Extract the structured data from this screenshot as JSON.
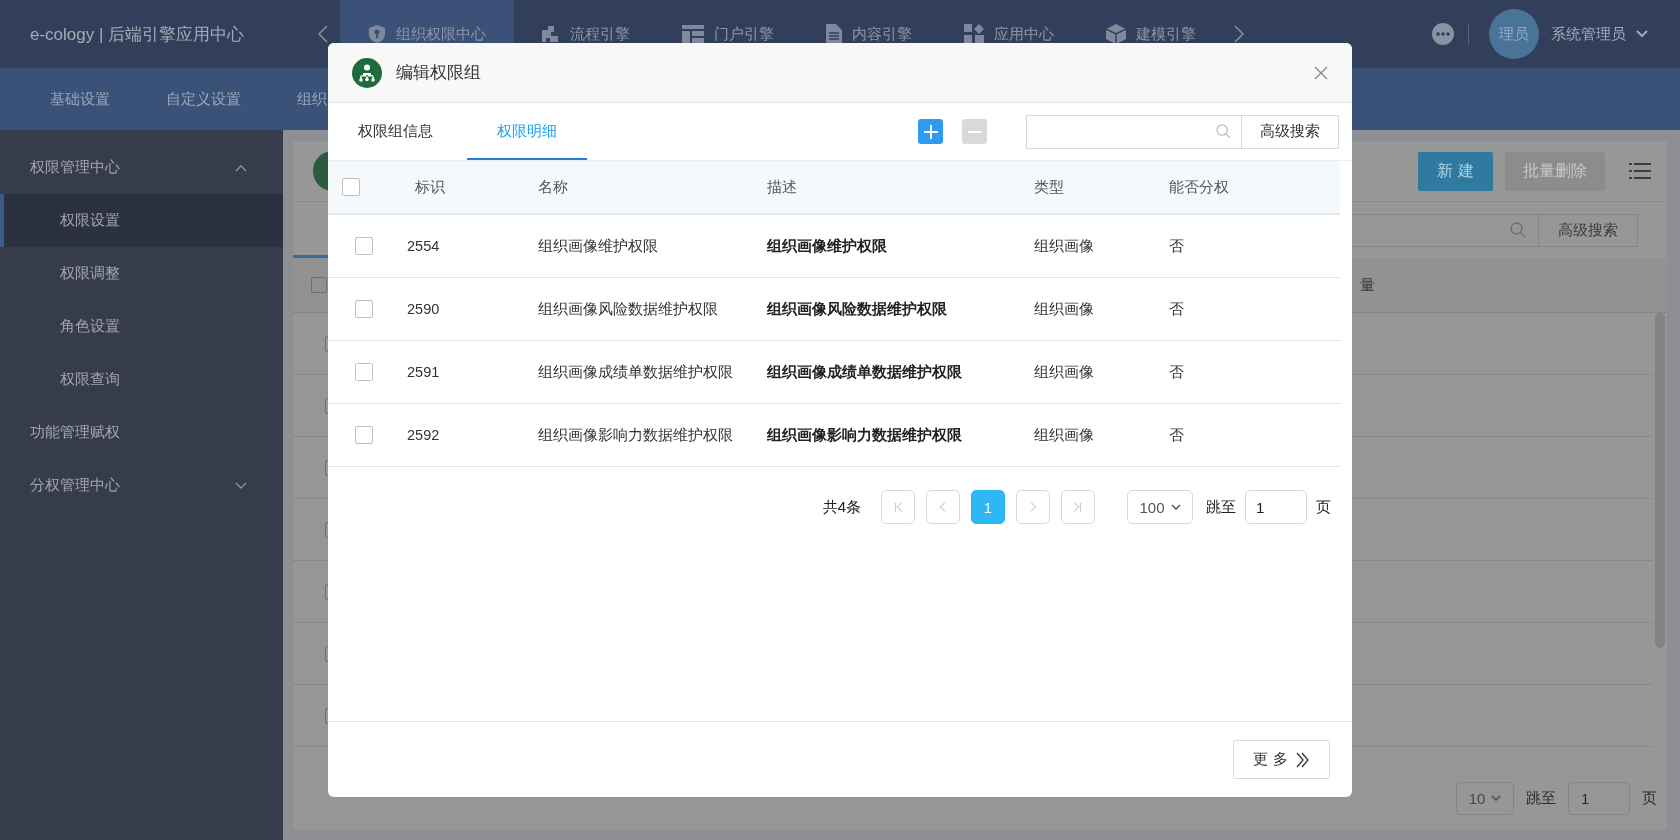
{
  "app": {
    "logo": "e-cology | 后端引擎应用中心"
  },
  "top_nav": {
    "tabs": [
      {
        "label": "组织权限中心",
        "selected": true
      },
      {
        "label": "流程引擎",
        "selected": false
      },
      {
        "label": "门户引擎",
        "selected": false
      },
      {
        "label": "内容引擎",
        "selected": false
      },
      {
        "label": "应用中心",
        "selected": false
      },
      {
        "label": "建模引擎",
        "selected": false
      }
    ]
  },
  "user": {
    "avatar_text": "理员",
    "name": "系统管理员"
  },
  "sub_nav": {
    "items": [
      "基础设置",
      "自定义设置",
      "组织"
    ]
  },
  "sidebar": {
    "items": [
      {
        "label": "权限管理中心",
        "kind": "group",
        "expanded": true,
        "children": [
          {
            "label": "权限设置",
            "selected": true
          },
          {
            "label": "权限调整",
            "selected": false
          },
          {
            "label": "角色设置",
            "selected": false
          },
          {
            "label": "权限查询",
            "selected": false
          }
        ]
      },
      {
        "label": "功能管理赋权",
        "kind": "link"
      },
      {
        "label": "分权管理中心",
        "kind": "group",
        "expanded": false
      }
    ]
  },
  "background": {
    "buttons": [
      {
        "label": "新 建",
        "disabled": false
      },
      {
        "label": "批量删除",
        "disabled": true
      }
    ],
    "search": {
      "button": "高级搜索"
    },
    "table": {
      "all_checked": false,
      "column_fragment": "量",
      "rows": [
        {
          "checked": false
        },
        {
          "checked": false
        },
        {
          "checked": false
        },
        {
          "checked": false
        },
        {
          "checked": false
        },
        {
          "checked": false
        },
        {
          "checked": false
        }
      ]
    },
    "pagination": {
      "page_size": "10",
      "jump_label": "跳至",
      "page_input": "1",
      "page_unit": "页"
    }
  },
  "modal": {
    "title": "编辑权限组",
    "tabs": [
      {
        "label": "权限组信息",
        "selected": false
      },
      {
        "label": "权限明细",
        "selected": true
      }
    ],
    "actions": [
      {
        "kind": "add",
        "disabled": false
      },
      {
        "kind": "remove",
        "disabled": true
      }
    ],
    "search": {
      "button": "高级搜索"
    },
    "table": {
      "all_checked": false,
      "columns": [
        "标识",
        "名称",
        "描述",
        "类型",
        "能否分权"
      ],
      "rows": [
        {
          "checked": false,
          "id": "2554",
          "name": "组织画像维护权限",
          "description": "组织画像维护权限",
          "type": "组织画像",
          "delegable": "否"
        },
        {
          "checked": false,
          "id": "2590",
          "name": "组织画像风险数据维护权限",
          "description": "组织画像风险数据维护权限",
          "type": "组织画像",
          "delegable": "否"
        },
        {
          "checked": false,
          "id": "2591",
          "name": "组织画像成绩单数据维护权限",
          "description": "组织画像成绩单数据维护权限",
          "type": "组织画像",
          "delegable": "否"
        },
        {
          "checked": false,
          "id": "2592",
          "name": "组织画像影响力数据维护权限",
          "description": "组织画像影响力数据维护权限",
          "type": "组织画像",
          "delegable": "否"
        }
      ]
    },
    "pagination": {
      "total": "共4条",
      "nav": [
        {
          "kind": "first",
          "disabled": true
        },
        {
          "kind": "prev",
          "disabled": true
        },
        {
          "kind": "next",
          "disabled": true
        },
        {
          "kind": "last",
          "disabled": true
        }
      ],
      "pages": [
        {
          "label": "1",
          "selected": true
        }
      ],
      "page_size": "100",
      "jump_label": "跳至",
      "page_input": "1",
      "page_unit": "页"
    },
    "more_button": "更 多"
  }
}
